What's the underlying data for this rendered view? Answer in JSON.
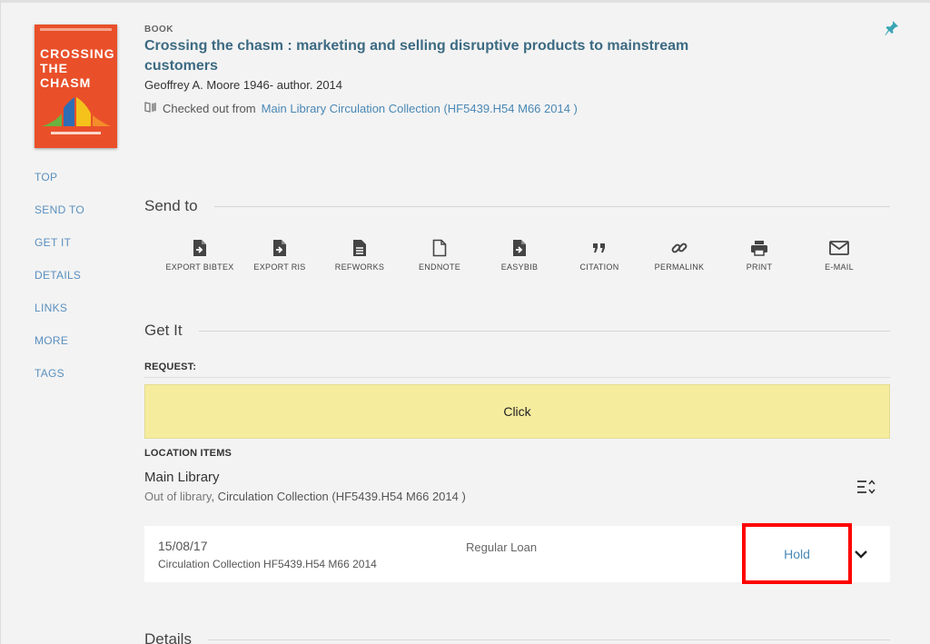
{
  "record": {
    "type": "BOOK",
    "title": "Crossing the chasm : marketing and selling disruptive products to mainstream customers",
    "author_line": "Geoffrey A. Moore 1946- author. 2014",
    "availability_prefix": "Checked out from",
    "availability_link": "Main Library  Circulation Collection (HF5439.H54 M66 2014 )",
    "cover_title": "CROSSING THE CHASM"
  },
  "nav": {
    "items": [
      "TOP",
      "SEND TO",
      "GET IT",
      "DETAILS",
      "LINKS",
      "MORE",
      "TAGS"
    ]
  },
  "send_to": {
    "heading": "Send to",
    "actions": [
      {
        "label": "EXPORT BIBTEX",
        "icon": "file-export-icon"
      },
      {
        "label": "EXPORT RIS",
        "icon": "file-export-icon"
      },
      {
        "label": "REFWORKS",
        "icon": "document-icon"
      },
      {
        "label": "ENDNOTE",
        "icon": "blank-file-icon"
      },
      {
        "label": "EASYBIB",
        "icon": "file-export-icon"
      },
      {
        "label": "CITATION",
        "icon": "quote-icon"
      },
      {
        "label": "PERMALINK",
        "icon": "link-icon"
      },
      {
        "label": "PRINT",
        "icon": "printer-icon"
      },
      {
        "label": "E-MAIL",
        "icon": "mail-icon"
      }
    ]
  },
  "get_it": {
    "heading": "Get It",
    "request_label": "REQUEST:",
    "request_button": "Click",
    "location_items_label": "LOCATION ITEMS",
    "location_name": "Main Library",
    "location_status_out": "Out of library",
    "location_status_rest": ", Circulation Collection (HF5439.H54 M66 2014 )",
    "item": {
      "date": "15/08/17",
      "call_number": "Circulation Collection HF5439.H54 M66 2014",
      "policy": "Regular Loan",
      "hold_label": "Hold"
    }
  },
  "details": {
    "heading": "Details"
  },
  "colors": {
    "link": "#4a88b5",
    "title": "#3c6a82",
    "request_bg": "#f5ec9e",
    "highlight": "#ff0000",
    "pin": "#3aa4b5"
  }
}
